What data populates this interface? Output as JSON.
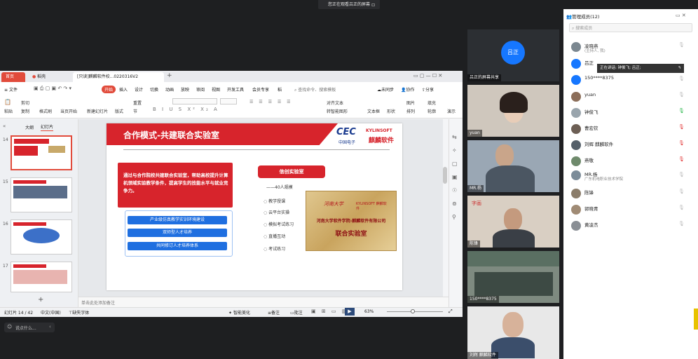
{
  "meeting": {
    "banner": "您正在观看吕正的屏幕",
    "chat_placeholder": "说点什么..."
  },
  "wps": {
    "tabs": [
      "首页",
      "稻壳",
      "[只读]麒麟软件校...0220316V2"
    ],
    "menu": [
      "文件",
      "开始",
      "插入",
      "设计",
      "切换",
      "动画",
      "放映",
      "审阅",
      "视图",
      "开发工具",
      "会员专享",
      "稻"
    ],
    "search": "查找命令、搜索模板",
    "right_menu": [
      "未同步",
      "协作",
      "分享"
    ],
    "ribbon_left": [
      "粘贴",
      "剪切",
      "复制",
      "格式刷",
      "当页开始",
      "新建幻灯片",
      "版式",
      "节",
      "重置"
    ],
    "ribbon_right": [
      "文本框",
      "形状",
      "排列",
      "轮廓",
      "图片",
      "填充",
      "对齐文本",
      "转智能图形",
      "演示"
    ],
    "pane_tabs": [
      "大纲",
      "幻灯片"
    ],
    "slide_numbers": [
      "14",
      "15",
      "16",
      "17"
    ],
    "note": "单击此处添加备注",
    "status": {
      "slide": "幻灯片 14 / 42",
      "lang": "中文(中国)",
      "font": "缺失字体",
      "smart": "智能美化",
      "notes": "备注",
      "comments": "批注",
      "zoom": "63%"
    }
  },
  "slide": {
    "title": "合作模式-共建联合实验室",
    "logo_cec": "CEC",
    "logo_cec_sub": "中国电子",
    "logo_ky": "KYLINSOFT",
    "logo_ky_sub": "麒麟软件",
    "intro": "通过与合作院校共建联合实验室，帮助高校提升计算机领域实验教学条件，提高学生的技能水平与就业竞争力。",
    "buttons": [
      "产业级仿真教学实训环境建设",
      "双师型人才培养",
      "共同修订人才培养体系"
    ],
    "lab_tag": "信创实验室",
    "capacity": "——40人规模",
    "items": [
      "教学授课",
      "云平台实操",
      "模拟考试练习",
      "直播互动",
      "考试练习"
    ],
    "plaque_univ": "河南大学",
    "plaque_partner": "KYLINSOFT 麒麟软件",
    "plaque_line1": "河南大学软件学院-麒麟软件有限公司",
    "plaque_line2": "联合实验室"
  },
  "videos": [
    {
      "label": "吕正的屏幕共享",
      "avatar": "吕正"
    },
    {
      "label": "yuan"
    },
    {
      "label": "MR.杨"
    },
    {
      "label": "陈锋"
    },
    {
      "label": "150****8375"
    },
    {
      "label": "刘辉 麒麟软件"
    }
  ],
  "members_panel": {
    "title": "管理成员(12)",
    "search_placeholder": "搜索成员",
    "tooltip": "正在讲话: 钟俊飞; 吕正;",
    "list": [
      {
        "name": "凌晓燕",
        "sub": "(主持人, 我)"
      },
      {
        "name": "吕正",
        "sub": ""
      },
      {
        "name": "150****8375",
        "sub": ""
      },
      {
        "name": "yuan",
        "sub": ""
      },
      {
        "name": "钟俊飞",
        "sub": ""
      },
      {
        "name": "曹宏钦",
        "sub": ""
      },
      {
        "name": "刘辉 麒麟软件",
        "sub": ""
      },
      {
        "name": "燕敬",
        "sub": ""
      },
      {
        "name": "MR.杨",
        "sub": "广东机电职业技术学院"
      },
      {
        "name": "陈锋",
        "sub": ""
      },
      {
        "name": "郭晓青",
        "sub": ""
      },
      {
        "name": "黄凌杰",
        "sub": ""
      }
    ]
  },
  "colors": {
    "wps_red": "#e14b3b",
    "slide_red": "#d7242c",
    "slide_blue": "#1f6fe0",
    "avatar_blue": "#1677ff"
  }
}
